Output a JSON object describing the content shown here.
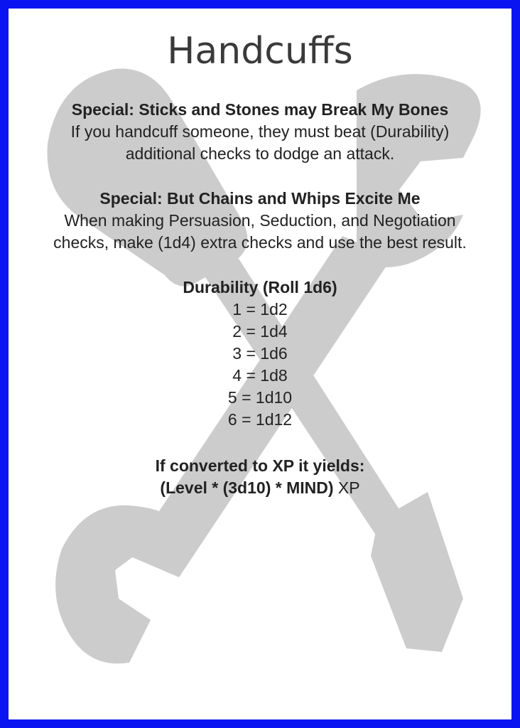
{
  "card": {
    "title": "Handcuffs",
    "special_1": {
      "heading": "Special: Sticks and Stones may Break My Bones",
      "text_line_1": "If you handcuff someone, they must beat (Durability)",
      "text_line_2": "additional checks to dodge an attack."
    },
    "special_2": {
      "heading": "Special: But Chains and Whips Excite Me",
      "text_line_1": "When making Persuasion, Seduction, and Negotiation",
      "text_line_2": "checks, make (1d4) extra checks and use the best result."
    },
    "durability": {
      "heading": "Durability (Roll 1d6)",
      "rows": [
        "1 = 1d2",
        "2 = 1d4",
        "3 = 1d6",
        "4 = 1d8",
        "5 = 1d10",
        "6 = 1d12"
      ]
    },
    "xp": {
      "heading": "If converted to XP it yields:",
      "formula": "(Level * (3d10) * MIND)",
      "suffix": "XP"
    }
  },
  "colors": {
    "border": "#0a14f0",
    "background_art": "#cccccc",
    "text": "#222222"
  },
  "icons": {
    "background": "crossed-wrench-screwdriver-icon"
  }
}
